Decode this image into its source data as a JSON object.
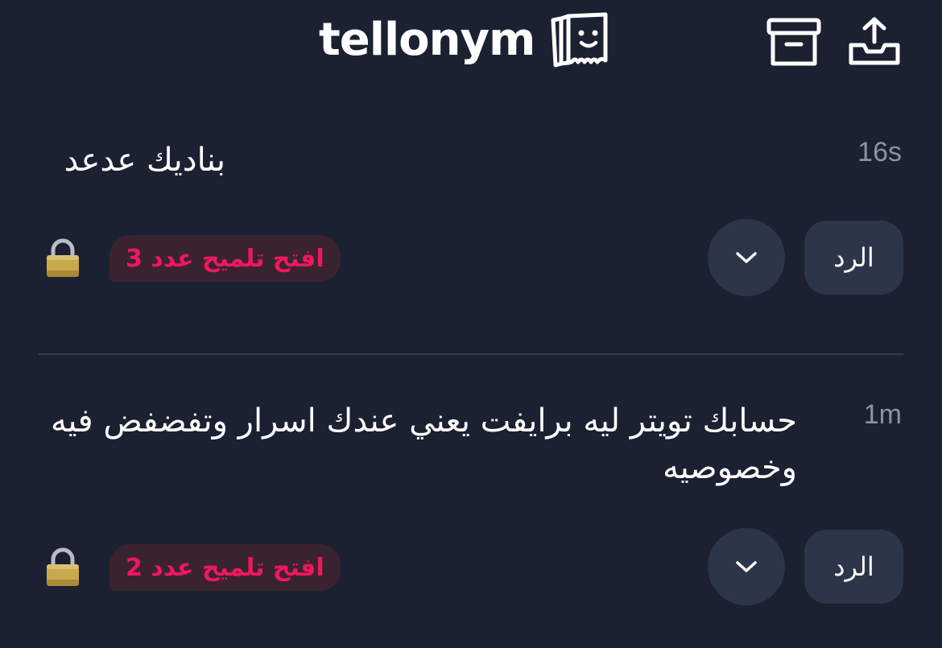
{
  "header": {
    "logo_text": "tellonym",
    "logo_icon": "paper-face-icon",
    "archive_icon": "archive-box-icon",
    "share_icon": "share-upload-icon"
  },
  "feed": {
    "tells": [
      {
        "text": "بناديك عدعد",
        "time": "16s",
        "hint_label": "افتح تلميح عدد 3",
        "reply_label": "الرد",
        "lock_icon": "lock-icon",
        "more_icon": "chevron-down-icon"
      },
      {
        "text": "حسابك تويتر ليه برايفت يعني عندك اسرار وتفضفض فيه وخصوصيه",
        "time": "1m",
        "hint_label": "افتح تلميح عدد 2",
        "reply_label": "الرد",
        "lock_icon": "lock-icon",
        "more_icon": "chevron-down-icon"
      }
    ]
  },
  "colors": {
    "background": "#1b2130",
    "button_bg": "#2c3648",
    "hint_bg": "#3a2330",
    "hint_text": "#f2165e",
    "time_text": "#8d93a1",
    "divider": "#323c4e"
  }
}
